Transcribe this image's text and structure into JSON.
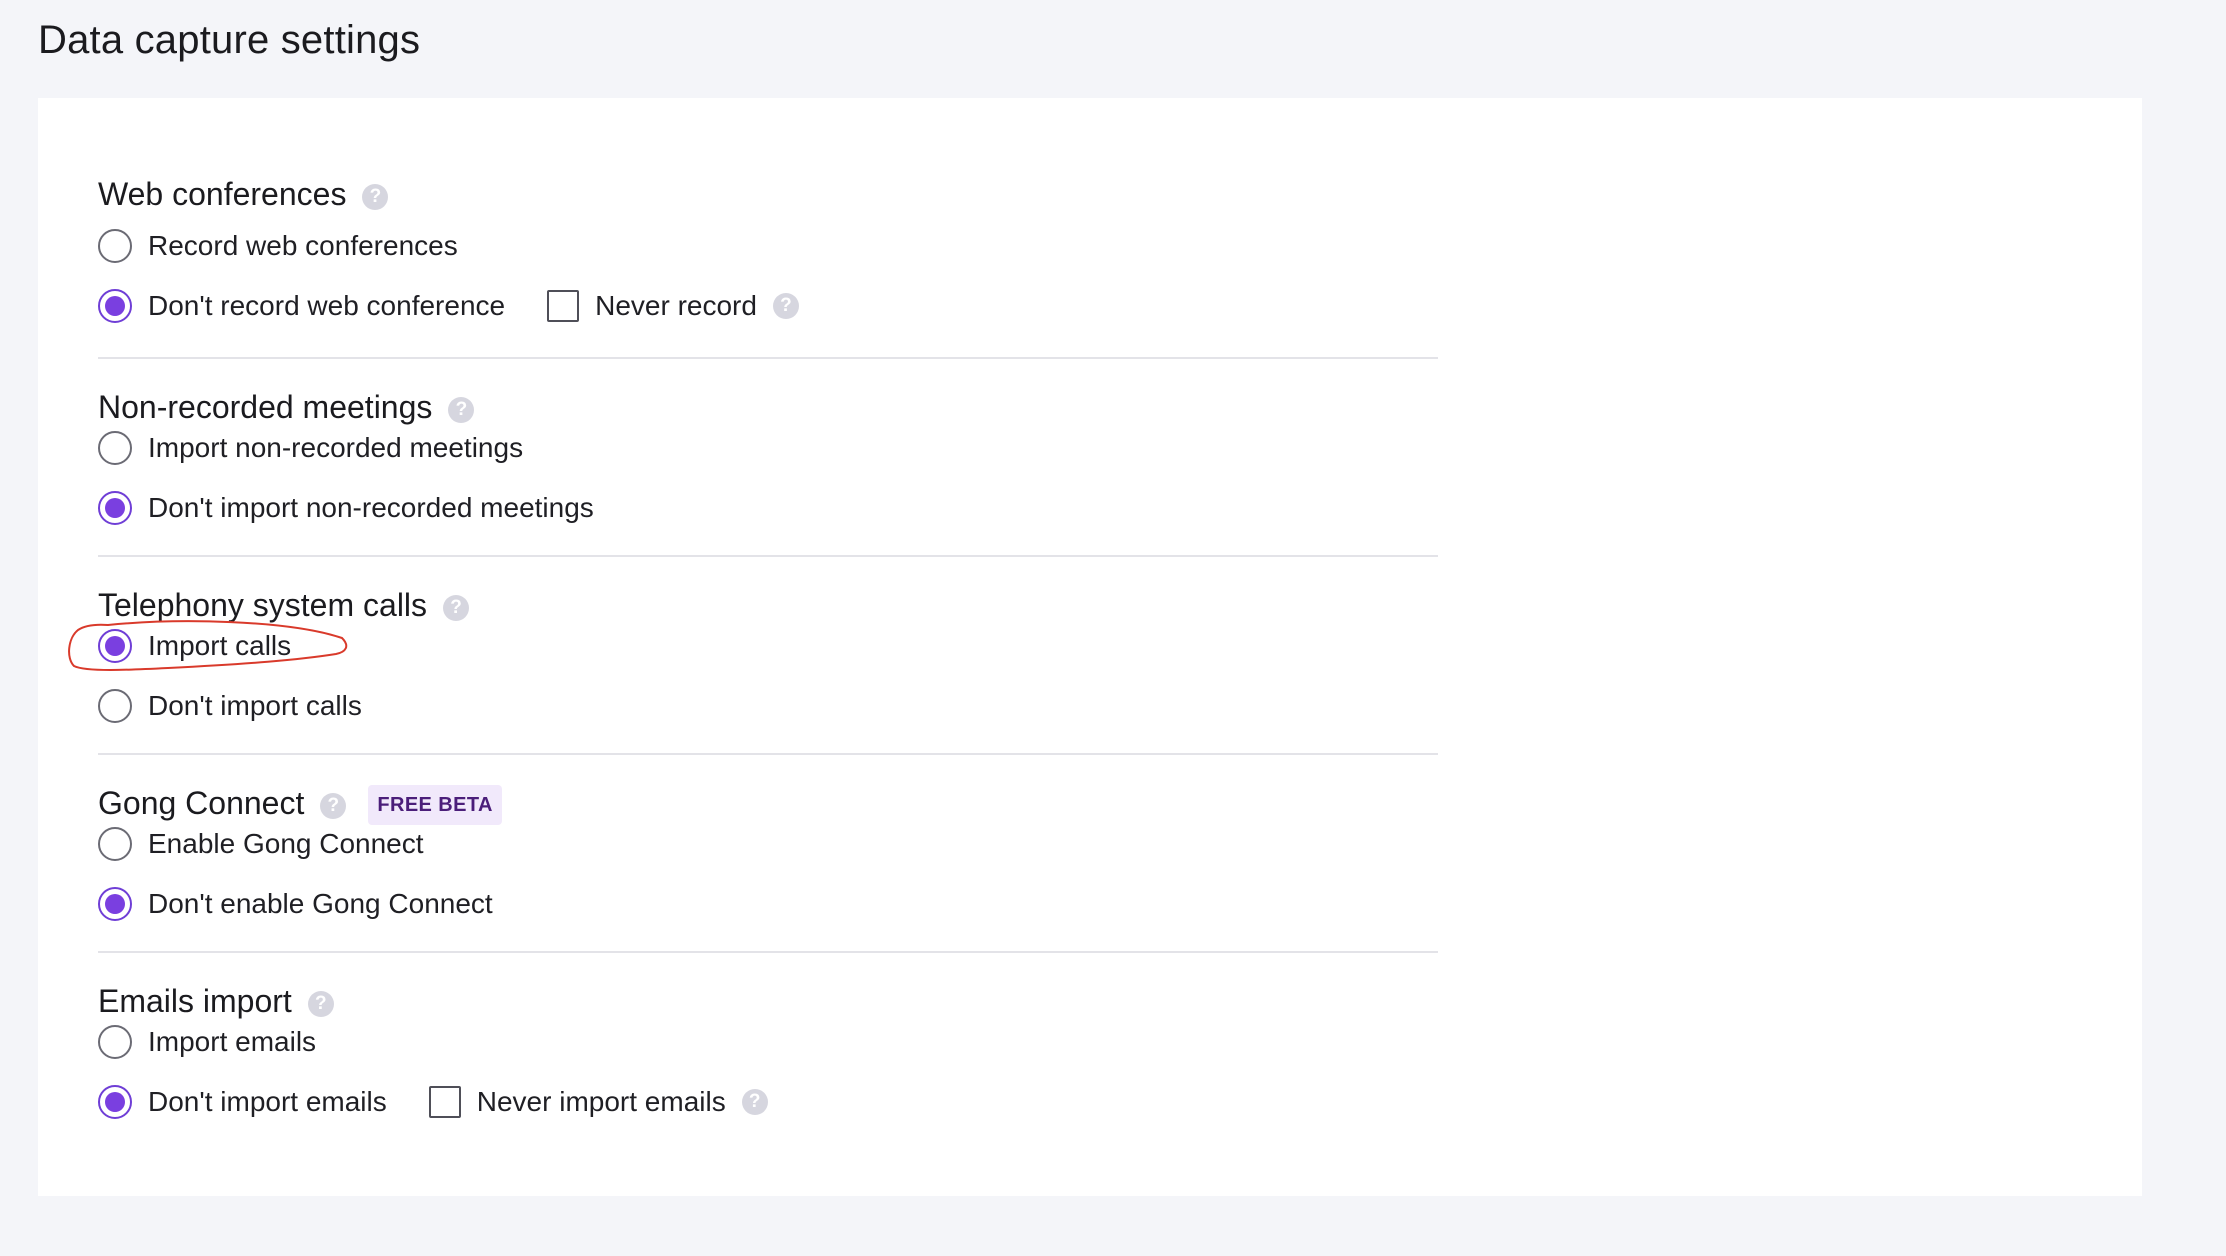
{
  "page": {
    "title": "Data capture settings"
  },
  "sections": {
    "web_conferences": {
      "title": "Web conferences",
      "options": [
        "Record web conferences",
        "Don't record web conference"
      ],
      "selected": "Don't record web conference",
      "checkbox_label": "Never record",
      "checkbox_checked": false
    },
    "non_recorded": {
      "title": "Non-recorded meetings",
      "options": [
        "Import non-recorded meetings",
        "Don't import non-recorded meetings"
      ],
      "selected": "Don't import non-recorded meetings"
    },
    "telephony": {
      "title": "Telephony system calls",
      "options": [
        "Import calls",
        "Don't import calls"
      ],
      "selected": "Import calls"
    },
    "gong_connect": {
      "title": "Gong Connect",
      "badge": "FREE BETA",
      "options": [
        "Enable Gong Connect",
        "Don't enable Gong Connect"
      ],
      "selected": "Don't enable Gong Connect"
    },
    "emails": {
      "title": "Emails import",
      "options": [
        "Import emails",
        "Don't import emails"
      ],
      "selected": "Don't import emails",
      "checkbox_label": "Never import emails",
      "checkbox_checked": false
    }
  },
  "help_glyph": "?",
  "colors": {
    "accent": "#7a3fe0",
    "annotation": "#d93a2b",
    "badge_bg": "#f1e9fb",
    "badge_text": "#4b1e7a",
    "help_icon": "#d6d6df"
  },
  "icons": {
    "help": "question-circle-icon"
  }
}
